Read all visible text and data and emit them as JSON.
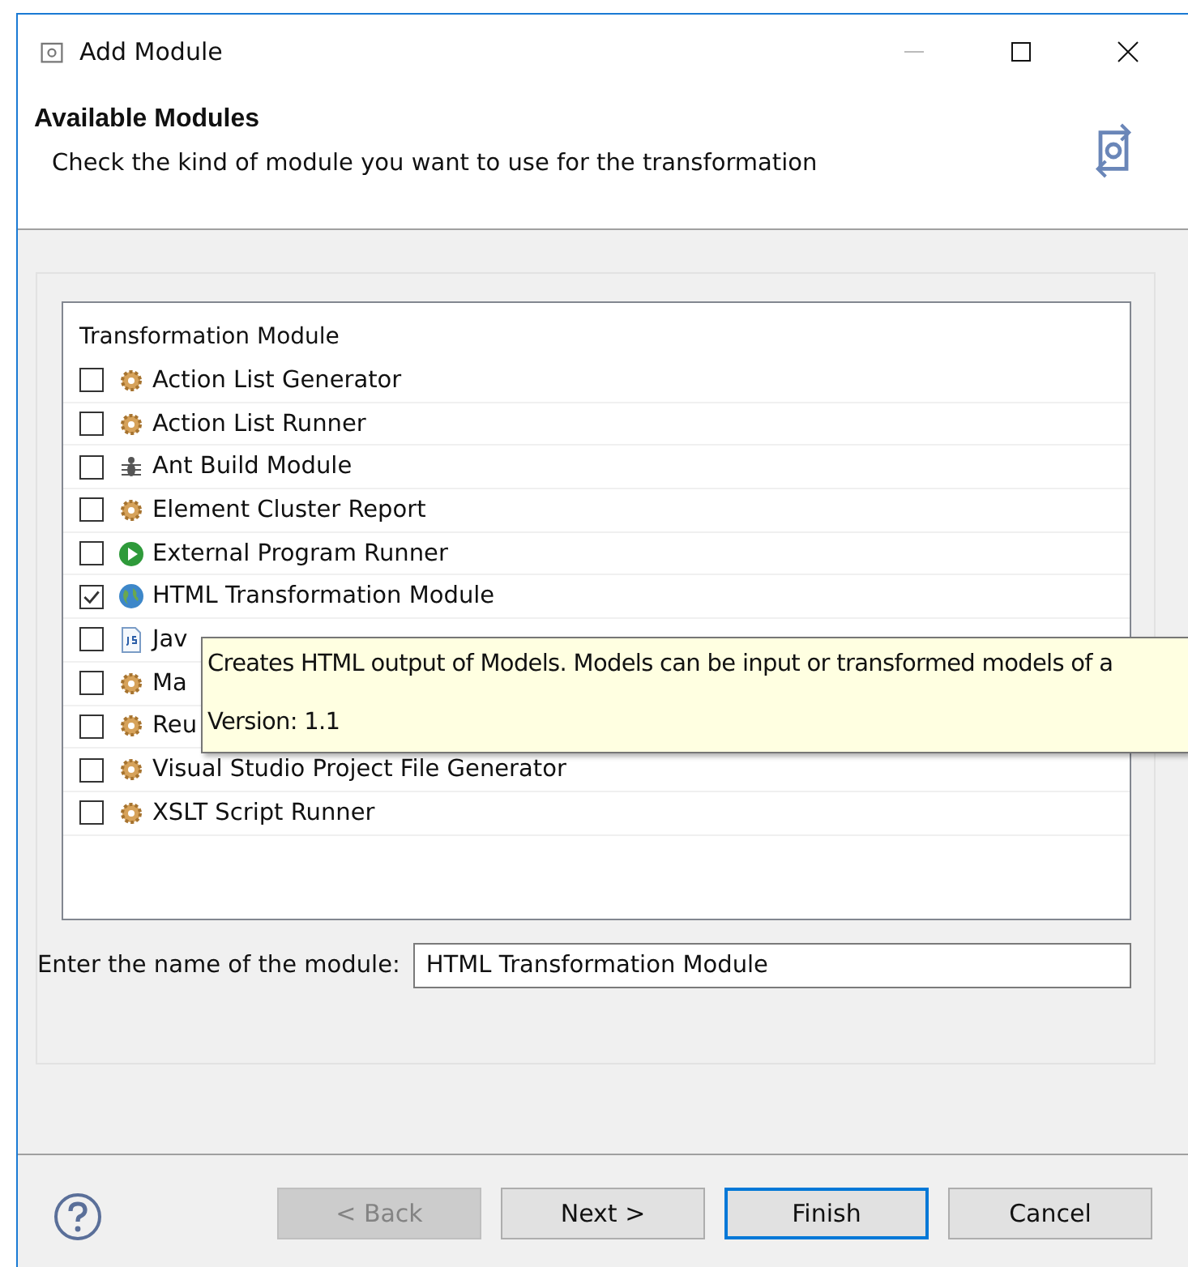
{
  "window": {
    "title": "Add Module"
  },
  "header": {
    "title": "Available Modules",
    "description": "Check the kind of module you want to use for the transformation"
  },
  "module_list": {
    "heading": "Transformation Module",
    "items": [
      {
        "label": "Action List Generator",
        "kind": "gear",
        "checked": false
      },
      {
        "label": "Action List Runner",
        "kind": "gear",
        "checked": false
      },
      {
        "label": "Ant Build Module",
        "kind": "ant",
        "checked": false
      },
      {
        "label": "Element Cluster Report",
        "kind": "gear",
        "checked": false
      },
      {
        "label": "External Program Runner",
        "kind": "play",
        "checked": false
      },
      {
        "label": "HTML Transformation Module",
        "kind": "globe",
        "checked": true
      },
      {
        "label": "Jav",
        "kind": "script",
        "checked": false
      },
      {
        "label": "Ma",
        "kind": "gear",
        "checked": false
      },
      {
        "label": "Reu",
        "kind": "gear",
        "checked": false
      },
      {
        "label": "Visual Studio Project File Generator",
        "kind": "gear",
        "checked": false
      },
      {
        "label": "XSLT Script Runner",
        "kind": "gear",
        "checked": false
      }
    ]
  },
  "tooltip": {
    "description": "Creates HTML output of Models. Models can be input or transformed models of a",
    "version": "Version: 1.1"
  },
  "name_field": {
    "label": "Enter the name of the module:",
    "value": "HTML Transformation Module"
  },
  "buttons": [
    {
      "label": "< Back",
      "disabled": true,
      "default": false
    },
    {
      "label": "Next >",
      "disabled": false,
      "default": false
    },
    {
      "label": "Finish",
      "disabled": false,
      "default": true
    },
    {
      "label": "Cancel",
      "disabled": false,
      "default": false
    }
  ]
}
